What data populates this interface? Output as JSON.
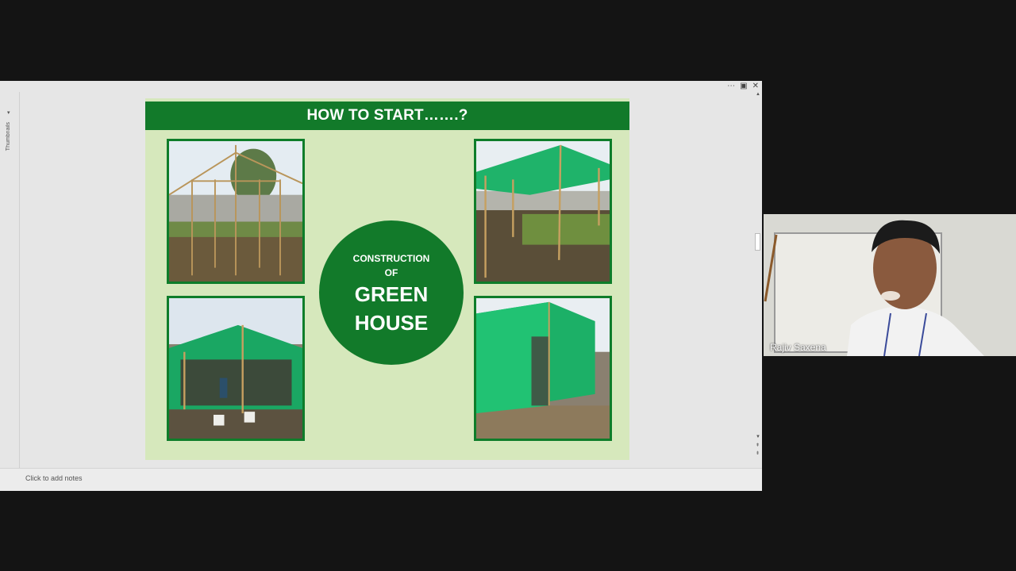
{
  "editor": {
    "thumbnails_label": "Thumbnails",
    "notes_placeholder": "Click to add notes",
    "window_controls": [
      "⋯",
      "▣",
      "✕"
    ]
  },
  "slide": {
    "title": "HOW TO START…….?",
    "center_line1": "CONSTRUCTION",
    "center_line2": "OF",
    "center_line3": "GREEN",
    "center_line4": "HOUSE"
  },
  "video": {
    "participant_name": "Rajiv Saxena"
  },
  "colors": {
    "slide_green": "#127a2a",
    "slide_bg": "#d6e8bc",
    "shade_net": "#1fb36a"
  }
}
